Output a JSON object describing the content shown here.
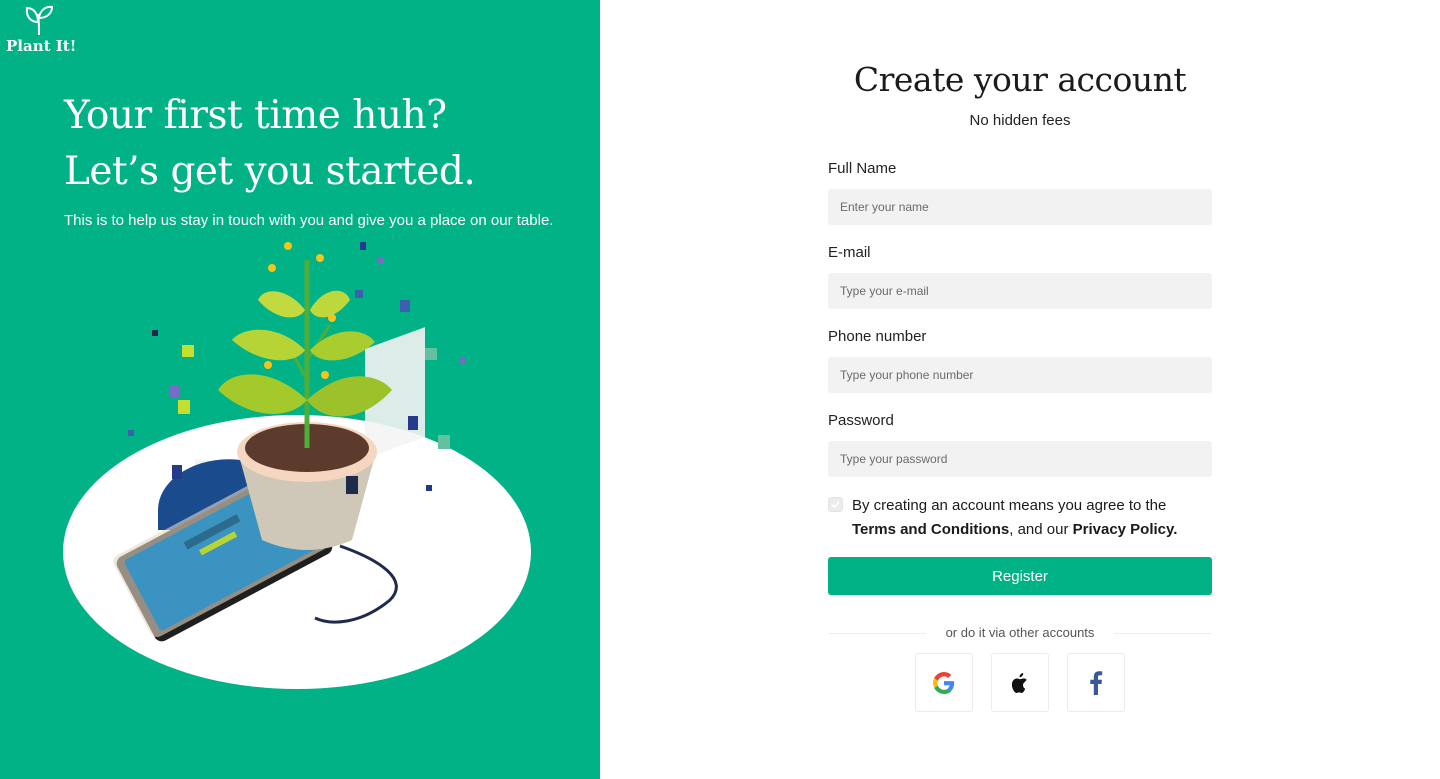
{
  "brand": {
    "name": "Plant It!",
    "accent": "#02b287"
  },
  "hero": {
    "title_line1": "Your first time huh?",
    "title_line2": "Let’s get you started.",
    "subtitle": "This is to help us stay in touch with you and give you a place on our table."
  },
  "form": {
    "title": "Create your account",
    "subtitle": "No hidden fees",
    "fields": [
      {
        "label": "Full Name",
        "placeholder": "Enter your name"
      },
      {
        "label": "E-mail",
        "placeholder": "Type your e-mail"
      },
      {
        "label": "Phone number",
        "placeholder": "Type your phone number"
      },
      {
        "label": "Password",
        "placeholder": "Type your password"
      }
    ],
    "agree": {
      "prefix": "By creating an account means you agree to the ",
      "terms": "Terms and Conditions",
      "middle": ", and our ",
      "privacy": "Privacy Policy."
    },
    "register_label": "Register",
    "divider_text": "or do it via other accounts",
    "social_icons": [
      "google-icon",
      "apple-icon",
      "facebook-icon"
    ]
  }
}
